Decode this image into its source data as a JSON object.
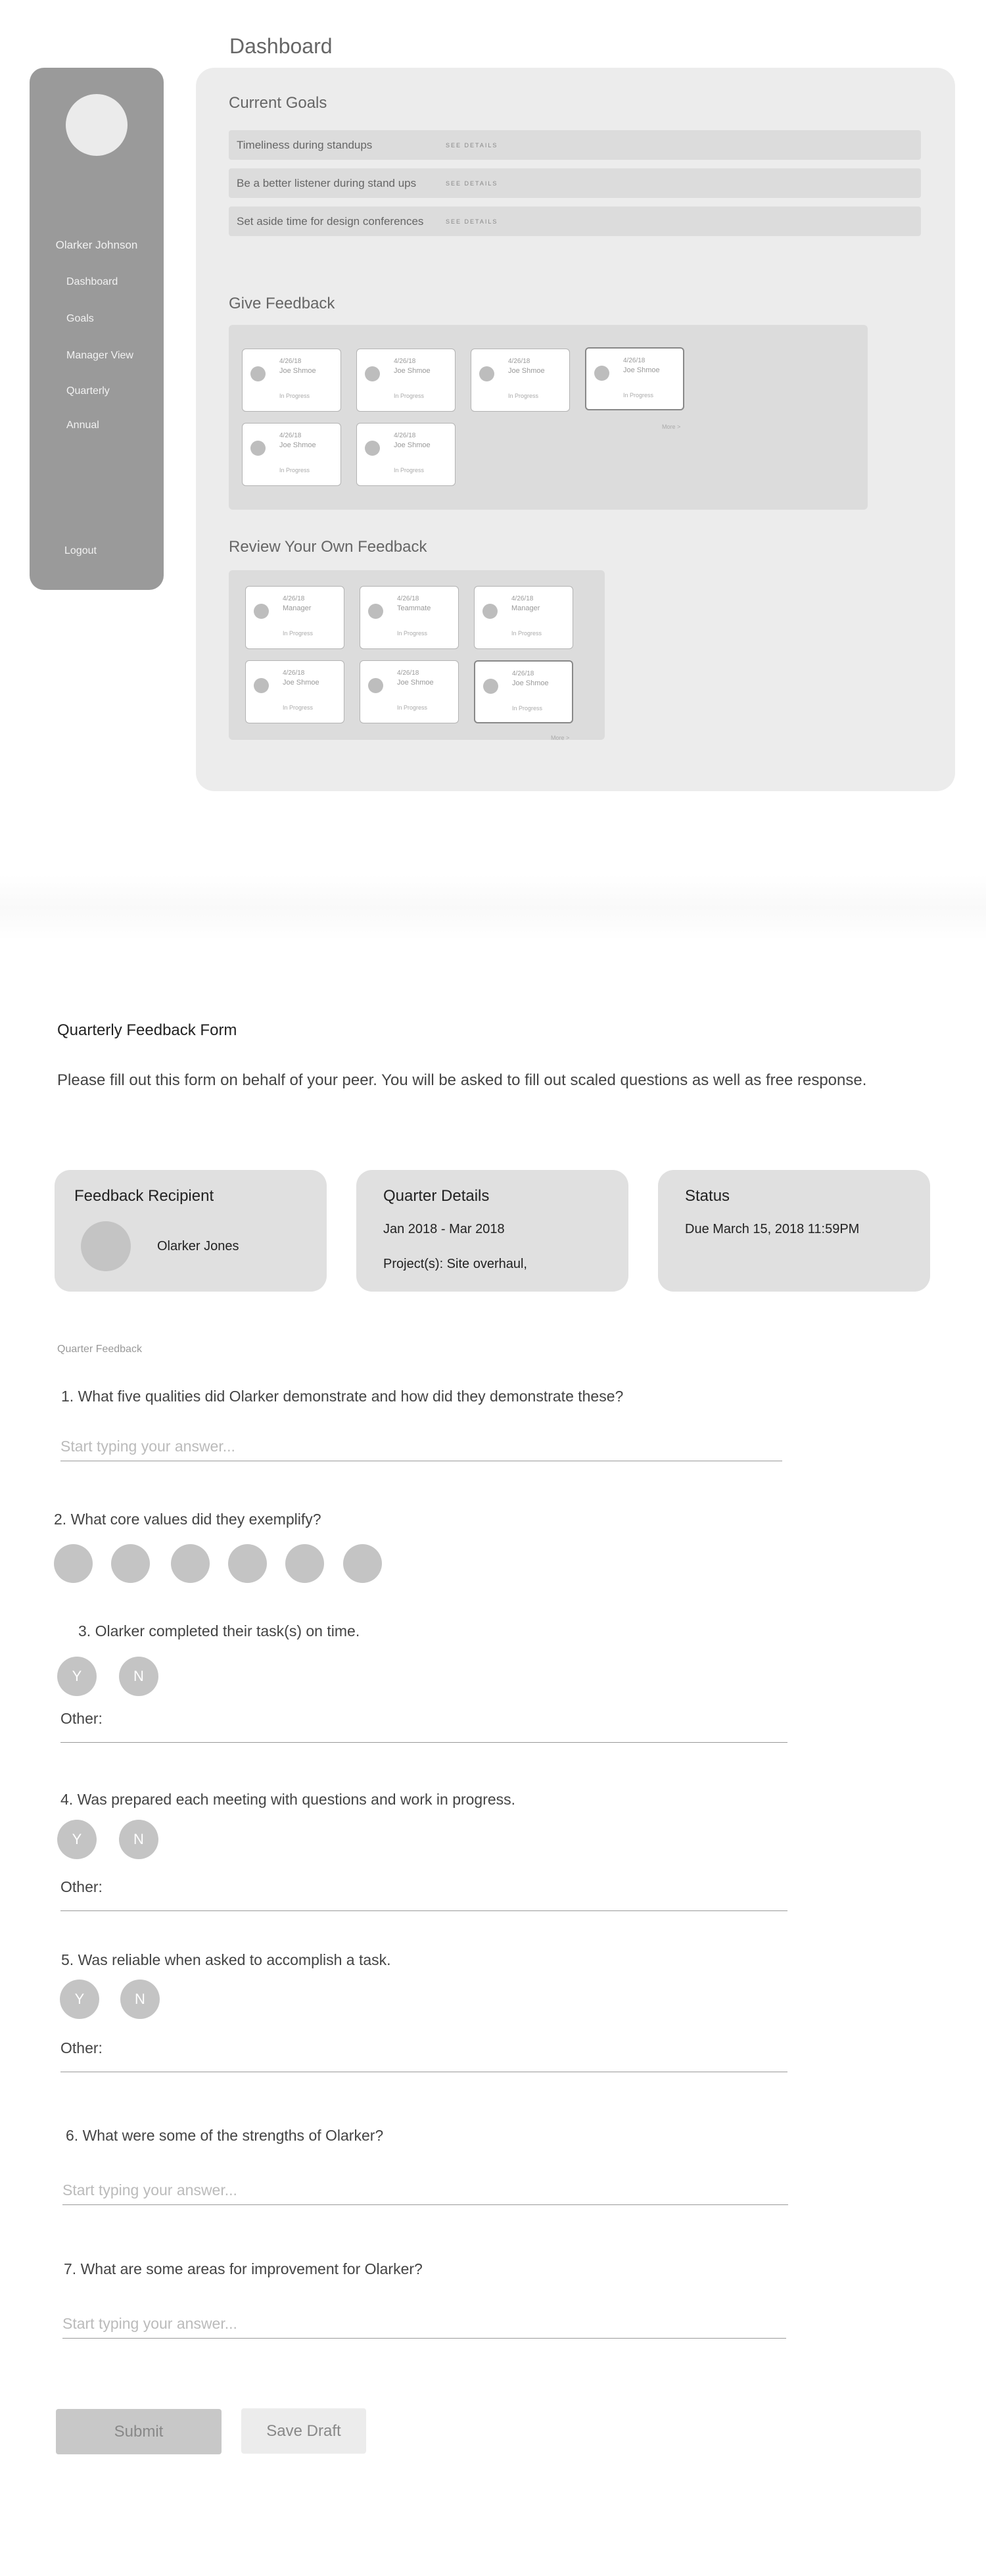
{
  "dashboard": {
    "title": "Dashboard",
    "sidebar": {
      "user_name": "Olarker Johnson",
      "nav": [
        "Dashboard",
        "Goals",
        "Manager View",
        "Quarterly",
        "Annual"
      ],
      "logout": "Logout"
    },
    "current_goals": {
      "title": "Current Goals",
      "link_label": "SEE DETAILS",
      "items": [
        "Timeliness during standups",
        "Be a better listener during stand ups",
        "Set aside time for design conferences"
      ]
    },
    "give_feedback": {
      "title": "Give Feedback",
      "more": "More  >",
      "cards": [
        {
          "date": "4/26/18",
          "name": "Joe Shmoe",
          "status": "In Progress"
        },
        {
          "date": "4/26/18",
          "name": "Joe Shmoe",
          "status": "In Progress"
        },
        {
          "date": "4/26/18",
          "name": "Joe Shmoe",
          "status": "In Progress"
        },
        {
          "date": "4/26/18",
          "name": "Joe Shmoe",
          "status": "In Progress"
        },
        {
          "date": "4/26/18",
          "name": "Joe Shmoe",
          "status": "In Progress"
        },
        {
          "date": "4/26/18",
          "name": "Joe Shmoe",
          "status": "In Progress"
        }
      ]
    },
    "review_own": {
      "title": "Review Your Own Feedback",
      "more": "More  >",
      "cards": [
        {
          "date": "4/26/18",
          "name": "Manager",
          "status": "In Progress"
        },
        {
          "date": "4/26/18",
          "name": "Teammate",
          "status": "In Progress"
        },
        {
          "date": "4/26/18",
          "name": "Manager",
          "status": "In Progress"
        },
        {
          "date": "4/26/18",
          "name": "Joe Shmoe",
          "status": "In Progress"
        },
        {
          "date": "4/26/18",
          "name": "Joe Shmoe",
          "status": "In Progress"
        },
        {
          "date": "4/26/18",
          "name": "Joe Shmoe",
          "status": "In Progress"
        }
      ]
    }
  },
  "form": {
    "title": "Quarterly Feedback Form",
    "intro": "Please fill out this form on behalf of your peer. You will be asked to fill out scaled questions as well as free response.",
    "recipient": {
      "title": "Feedback Recipient",
      "name": "Olarker Jones"
    },
    "quarter": {
      "title": "Quarter Details",
      "range": "Jan 2018 - Mar 2018",
      "projects": "Project(s): Site overhaul,"
    },
    "status": {
      "title": "Status",
      "due": "Due March 15, 2018 11:59PM"
    },
    "section_label": "Quarter Feedback",
    "answer_placeholder": "Start typing your answer...",
    "yes": "Y",
    "no": "N",
    "other_label": "Other:",
    "questions": [
      "1. What five qualities did Olarker demonstrate and how did they demonstrate these?",
      "2. What core values did they exemplify?",
      "3. Olarker completed their task(s) on time.",
      "4. Was prepared each meeting with questions and work in progress.",
      "5. Was reliable when asked to accomplish a task.",
      "6. What were some of the strengths of Olarker?",
      "7. What are some areas for improvement for Olarker?"
    ],
    "submit_label": "Submit",
    "save_draft_label": "Save Draft"
  }
}
